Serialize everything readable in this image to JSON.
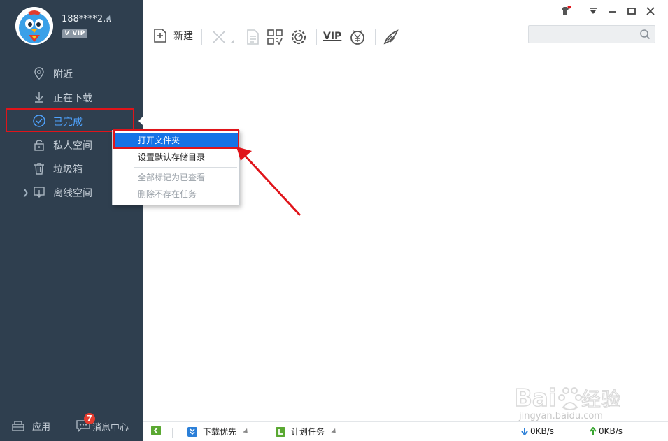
{
  "user": {
    "name": "188****2...",
    "vip_label": "VIP"
  },
  "sidebar": {
    "items": [
      {
        "label": "附近",
        "icon": "location-pin-icon"
      },
      {
        "label": "正在下载",
        "icon": "download-icon"
      },
      {
        "label": "已完成",
        "icon": "check-circle-icon"
      },
      {
        "label": "私人空间",
        "icon": "lock-icon"
      },
      {
        "label": "垃圾箱",
        "icon": "trash-icon"
      },
      {
        "label": "离线空间",
        "icon": "cloud-download-icon"
      }
    ],
    "bottom": {
      "apps_label": "应用",
      "messages_label": "消息中心",
      "messages_badge": "7"
    }
  },
  "toolbar": {
    "new_label": "新建",
    "vip_label": "VIP"
  },
  "context_menu": {
    "items": [
      {
        "label": "打开文件夹",
        "state": "selected"
      },
      {
        "label": "设置默认存储目录",
        "state": "enabled"
      },
      {
        "label": "全部标记为已查看",
        "state": "disabled"
      },
      {
        "label": "删除不存在任务",
        "state": "disabled"
      }
    ]
  },
  "status_bar": {
    "download_priority": "下载优先",
    "schedule": "计划任务",
    "download_speed": "0KB/s",
    "upload_speed": "0KB/s"
  },
  "watermark": {
    "url": "jingyan.baidu.com"
  },
  "colors": {
    "sidebar_bg": "#2f3f4f",
    "active_blue": "#4fa3ff",
    "menu_selected": "#1673e6",
    "annotation_red": "#e0141a",
    "status_green": "#5aa832",
    "status_blue": "#2b7fd8"
  }
}
